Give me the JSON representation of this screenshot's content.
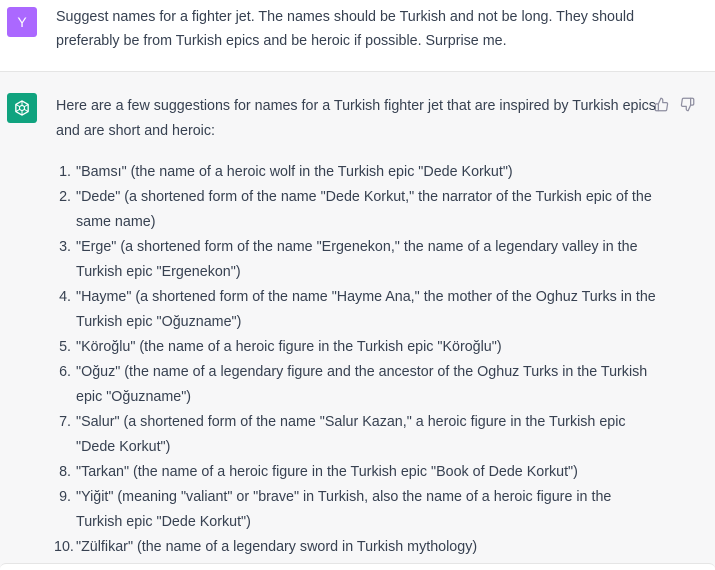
{
  "user": {
    "avatar_letter": "Y",
    "message": "Suggest names for a fighter jet. The names should be Turkish and not be long. They should preferably be from Turkish epics and be heroic if possible. Surprise me."
  },
  "assistant": {
    "icon": "openai-logo-icon",
    "intro": "Here are a few suggestions for names for a Turkish fighter jet that are inspired by Turkish epics and are short and heroic:",
    "items": [
      {
        "num": "1.",
        "text": "\"Bamsı\" (the name of a heroic wolf in the Turkish epic \"Dede Korkut\")"
      },
      {
        "num": "2.",
        "text": "\"Dede\" (a shortened form of the name \"Dede Korkut,\" the narrator of the Turkish epic of the same name)"
      },
      {
        "num": "3.",
        "text": "\"Erge\" (a shortened form of the name \"Ergenekon,\" the name of a legendary valley in the Turkish epic \"Ergenekon\")"
      },
      {
        "num": "4.",
        "text": "\"Hayme\" (a shortened form of the name \"Hayme Ana,\" the mother of the Oghuz Turks in the Turkish epic \"Oğuzname\")"
      },
      {
        "num": "5.",
        "text": "\"Köroğlu\" (the name of a heroic figure in the Turkish epic \"Köroğlu\")"
      },
      {
        "num": "6.",
        "text": "\"Oğuz\" (the name of a legendary figure and the ancestor of the Oghuz Turks in the Turkish epic \"Oğuzname\")"
      },
      {
        "num": "7.",
        "text": "\"Salur\" (a shortened form of the name \"Salur Kazan,\" a heroic figure in the Turkish epic \"Dede Korkut\")"
      },
      {
        "num": "8.",
        "text": "\"Tarkan\" (the name of a heroic figure in the Turkish epic \"Book of Dede Korkut\")"
      },
      {
        "num": "9.",
        "text": "\"Yiğit\" (meaning \"valiant\" or \"brave\" in Turkish, also the name of a heroic figure in the Turkish epic \"Dede Korkut\")"
      },
      {
        "num": "10.",
        "text": "\"Zülfikar\" (the name of a legendary sword in Turkish mythology)"
      }
    ]
  },
  "colors": {
    "user_avatar": "#ab68ff",
    "assistant_avatar": "#10a37f",
    "assistant_bg": "#f7f7f8",
    "text": "#374151"
  }
}
